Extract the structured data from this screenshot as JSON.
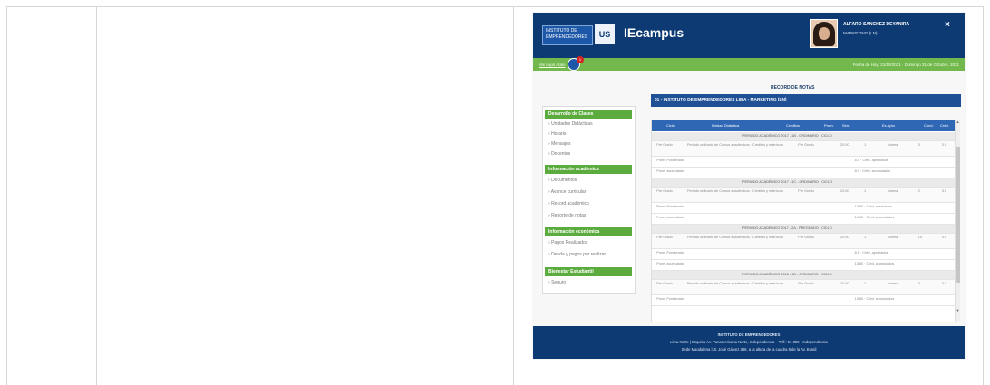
{
  "header": {
    "logo_text": "INSTITUTO DE EMPRENDEDORES",
    "logo_mark": "US",
    "brand": "IEcampus",
    "user_name": "ALFARO SANCHEZ DEYANIRA",
    "user_program": "MARKETING (LN)",
    "close_icon": "×"
  },
  "greenbar": {
    "left_link": "Mis Hijos Atalo",
    "badge_count": "1",
    "right_text": "Fecha de Hoy: 21/10/2021 · Domingo 31 de Octubre, 2021"
  },
  "sidebar": {
    "sections": [
      {
        "title": "Desarrollo de Clases",
        "items": [
          "Unidades Didácticas",
          "Horario",
          "Mensajes",
          "Docentes"
        ]
      },
      {
        "title": "Información académica",
        "items": [
          "Documentos",
          "Avance curricular",
          "Record académico",
          "Reporte de notas"
        ]
      },
      {
        "title": "Información económica",
        "items": [
          "Pagos Realizados",
          "Deuda y pagos por realizar"
        ]
      },
      {
        "title": "Bienestar Estudiantil",
        "items": [
          "Seguro"
        ]
      }
    ]
  },
  "main": {
    "title": "RECORD DE NOTAS",
    "institution": "01 - INSTITUTO DE EMPRENDEDORES LIMA - MARKETING (LN)",
    "columns": [
      "Ciclo",
      "Unidad Didáctica",
      "Créditos",
      "Prom.",
      "Sem.",
      "Es Apto",
      "Cond.",
      "Créd."
    ],
    "rows": [
      {
        "type": "period",
        "text": "PERIODO ACADÉMICO 2017 - 1B - ORDINARIO - CICLO"
      },
      {
        "type": "course",
        "cells": [
          "Pre Grado",
          "Periodo ordinario de Cursos académicos · Créditos y matrícula",
          "Pre Grado",
          "20.00",
          "1",
          "Normal",
          "3",
          "3.0"
        ]
      },
      {
        "type": "sum",
        "cells": [
          "Prom. Ponderado",
          "8.0 · Créd. aprobados",
          "8.0"
        ]
      },
      {
        "type": "sum",
        "cells": [
          "Prom. acumulado",
          "8.0 · Créd. acumulados",
          "8.0"
        ]
      },
      {
        "type": "period",
        "text": "PERIODO ACADÉMICO 2017 - 1C - ORDINARIO - CICLO"
      },
      {
        "type": "course",
        "cells": [
          "Pre Grado",
          "Periodo ordinario de Cursos académicos · Créditos y matrícula",
          "Pre Grado",
          "20.00",
          "1",
          "Normal",
          "2",
          "3.0"
        ]
      },
      {
        "type": "sum",
        "cells": [
          "Prom. Ponderado",
          "13.80 · Créd. aprobados",
          "30.0"
        ]
      },
      {
        "type": "sum",
        "cells": [
          "Prom. acumulado",
          "14.12 · Créd. acumulados",
          "30.0"
        ]
      },
      {
        "type": "period",
        "text": "PERIODO ACADÉMICO 2017 - 2A - PREGRADO - CICLO"
      },
      {
        "type": "course",
        "cells": [
          "Pre Grado",
          "Periodo ordinario de Cursos académicos · Créditos y matrícula",
          "Pre Grado",
          "20.00",
          "1",
          "Normal",
          "15",
          "3.0"
        ]
      },
      {
        "type": "sum",
        "cells": [
          "Prom. Ponderado",
          "8.6 · Créd. aprobados",
          "3.0"
        ]
      },
      {
        "type": "sum",
        "cells": [
          "Prom. acumulado",
          "13.80 · Créd. acumulados",
          "19.0"
        ]
      },
      {
        "type": "period",
        "text": "PERIODO ACADÉMICO 2018 - 1B - ORDINARIO - CICLO"
      },
      {
        "type": "course",
        "cells": [
          "Pre Grado",
          "Periodo ordinario de Cursos académicos · Créditos y matrícula",
          "Pre Grado",
          "20.00",
          "1",
          "Normal",
          "3",
          "3.0"
        ]
      },
      {
        "type": "sum",
        "cells": [
          "Prom. Ponderado",
          "13.80 · Créd. acumulados",
          "19.0"
        ]
      }
    ]
  },
  "footer": {
    "line1": "INSTITUTO DE EMPRENDEDORES",
    "line2": "Lima Norte | Esquina Av. Panamericana Norte, Independencia – Telf.: 01 385 · Independencia",
    "line3": "Sede Magdalena | Jr. José Gálvez 286, a la altura de la cuadra 8 de la Av. Brasil"
  },
  "colors": {
    "header": "#0d3a73",
    "green_bar": "#73b84d",
    "section_green": "#5cab3e",
    "table_header": "#2f67b5"
  },
  "icons": {
    "close": "close-icon",
    "notification": "notification-icon",
    "scroll_up": "chevron-up-icon",
    "scroll_down": "chevron-down-icon"
  }
}
